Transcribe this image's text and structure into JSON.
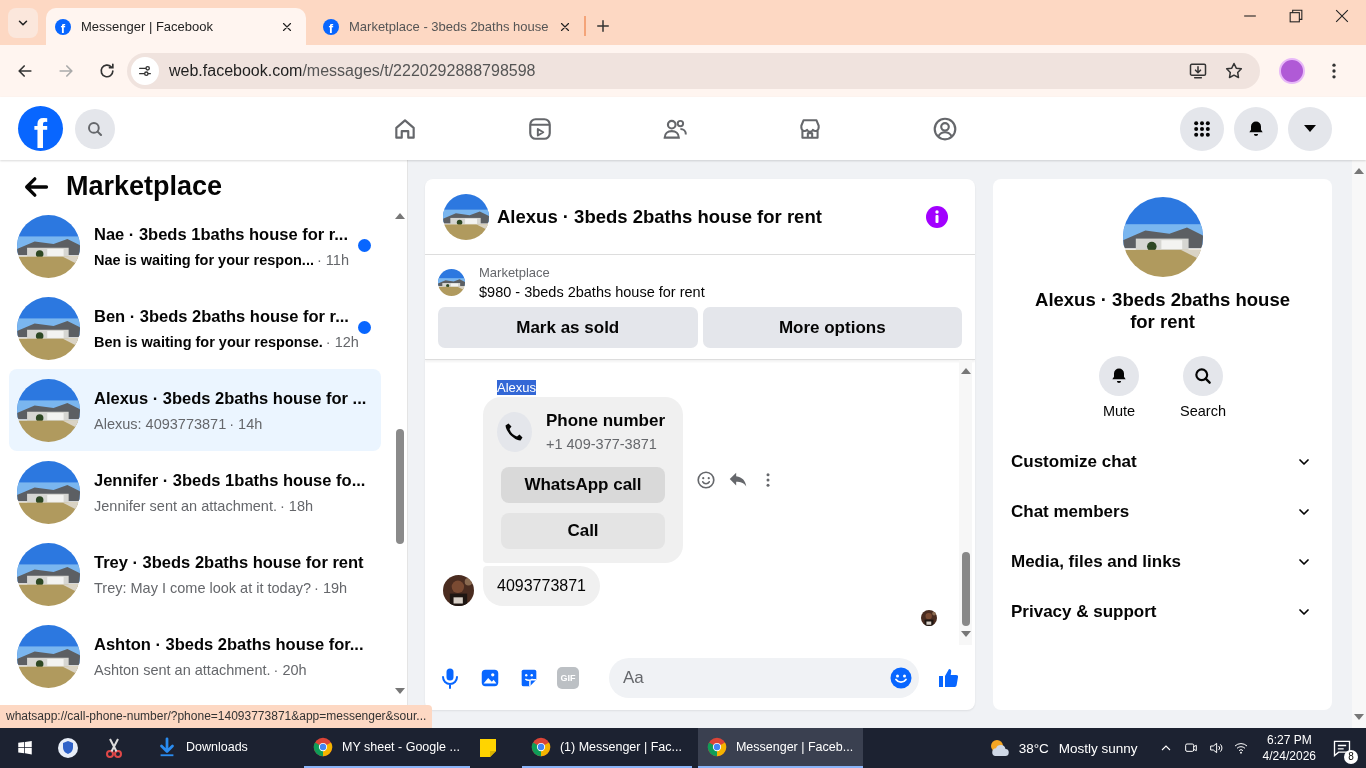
{
  "browser": {
    "tabs": [
      {
        "icon": "f",
        "title": "Messenger | Facebook",
        "selected": true
      },
      {
        "icon": "f",
        "title": "Marketplace - 3beds 2baths house",
        "selected": false
      }
    ],
    "url": "web.facebook.com/messages/t/2220292888798598"
  },
  "header": {
    "logo": "f"
  },
  "left": {
    "title": "Marketplace",
    "conversations": [
      {
        "name": "Nae · 3beds 1baths house for r...",
        "preview": "Nae is waiting for your respon...",
        "time": "· 11h",
        "unread": true,
        "selected": false
      },
      {
        "name": "Ben · 3beds 2baths house for r...",
        "preview": "Ben is waiting for your response.",
        "time": "· 12h",
        "unread": true,
        "selected": false
      },
      {
        "name": "Alexus · 3beds 2baths house for ...",
        "preview": "Alexus: 4093773871",
        "time": "· 14h",
        "unread": false,
        "selected": true
      },
      {
        "name": "Jennifer · 3beds 1baths house fo...",
        "preview": "Jennifer sent an attachment.",
        "time": "· 18h",
        "unread": false,
        "selected": false
      },
      {
        "name": "Trey · 3beds 2baths house for rent",
        "preview": "Trey: May I come look at it today?",
        "time": "· 19h",
        "unread": false,
        "selected": false
      },
      {
        "name": "Ashton · 3beds 2baths house for...",
        "preview": "Ashton sent an attachment.",
        "time": "· 20h",
        "unread": false,
        "selected": false
      }
    ]
  },
  "center": {
    "title": "Alexus · 3beds 2baths house for rent",
    "listing": {
      "label": "Marketplace",
      "title": "$980 - 3beds 2baths house for rent",
      "buttons": [
        "Mark as sold",
        "More options"
      ]
    },
    "messages": [
      {
        "kind": "contact_card",
        "sender": "Alexus",
        "sender_highlighted": true,
        "title": "Phone number",
        "number": "+1 409-377-3871",
        "buttons": [
          "WhatsApp call",
          "Call"
        ]
      },
      {
        "kind": "text",
        "text": "4093773871"
      }
    ],
    "composer": {
      "gif": "GIF",
      "placeholder": "Aa"
    }
  },
  "right": {
    "title": "Alexus · 3beds 2baths house for rent",
    "actions": [
      {
        "kind": "mute",
        "label": "Mute"
      },
      {
        "kind": "search",
        "label": "Search"
      }
    ],
    "sections": [
      {
        "label": "Customize chat",
        "expanded": false
      },
      {
        "label": "Chat members",
        "expanded": false
      },
      {
        "label": "Media, files and links",
        "expanded": false
      },
      {
        "label": "Privacy & support",
        "expanded": false
      }
    ]
  },
  "status_link": "whatsapp://call-phone-number/?phone=14093773871&app=messenger&sour...",
  "taskbar": {
    "apps": [
      {
        "kind": "download",
        "label": "Downloads",
        "selected": false
      },
      {
        "kind": "browser",
        "label": "MY sheet - Google ...",
        "selected": false
      },
      {
        "kind": "note"
      },
      {
        "kind": "browser",
        "label": "(1) Messenger | Fac...",
        "selected": false
      },
      {
        "kind": "browser",
        "label": "Messenger | Faceb...",
        "selected": true
      }
    ],
    "temperature": "38°C",
    "weather": "Mostly sunny",
    "time": "6:27 PM",
    "date": "4/24/2026",
    "notifications": "8"
  }
}
